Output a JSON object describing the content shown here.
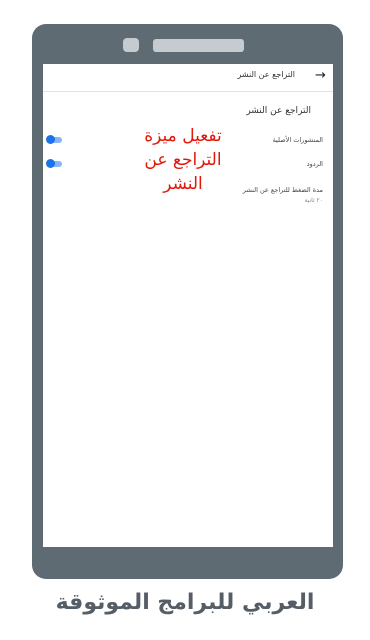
{
  "screen": {
    "top_title": "التراجع عن النشر",
    "back_icon": "arrow-forward-icon",
    "section_title": "التراجع عن النشر",
    "rows": [
      {
        "label": "المنشورات الأصلية",
        "toggle_on": true
      },
      {
        "label": "الردود",
        "toggle_on": true
      },
      {
        "label": "مدة الضغط للتراجع عن النشر",
        "sub": "٢٠ ثانية"
      }
    ]
  },
  "overlay": {
    "line1": "تفعيل ميزة",
    "line2": "التراجع عن",
    "line3": "النشر",
    "color": "#e3170a"
  },
  "caption": "العربي للبرامج الموثوقة",
  "colors": {
    "device": "#5e6b73",
    "toggle_accent": "#1a73e8"
  }
}
